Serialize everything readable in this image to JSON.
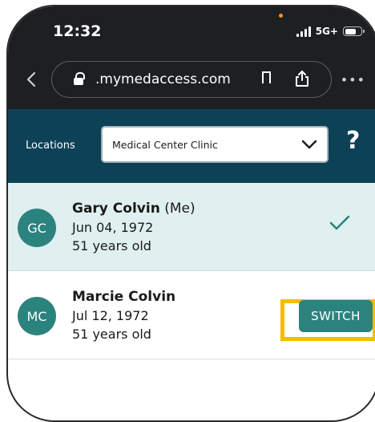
{
  "status_bar": {
    "time": "12:32",
    "network": "5G+"
  },
  "browser": {
    "back_icon": "chevron-left-icon",
    "url_faded": "",
    "url": ".mymedaccess.com",
    "more_icon": "ellipsis-icon"
  },
  "locations": {
    "label": "Locations",
    "selected": "Medical Center Clinic",
    "help": "?"
  },
  "profiles": [
    {
      "initials": "GC",
      "name": "Gary Colvin",
      "suffix": " (Me)",
      "dob": "Jun 04, 1972",
      "age": "51 years old",
      "active": true
    },
    {
      "initials": "MC",
      "name": "Marcie Colvin",
      "suffix": "",
      "dob": "Jul 12, 1972",
      "age": "51 years old",
      "action_label": "SWITCH"
    }
  ],
  "colors": {
    "header_bg": "#0d4156",
    "accent_teal": "#2b837e",
    "highlight": "#f5bc00",
    "active_row_bg": "#e0efef"
  }
}
